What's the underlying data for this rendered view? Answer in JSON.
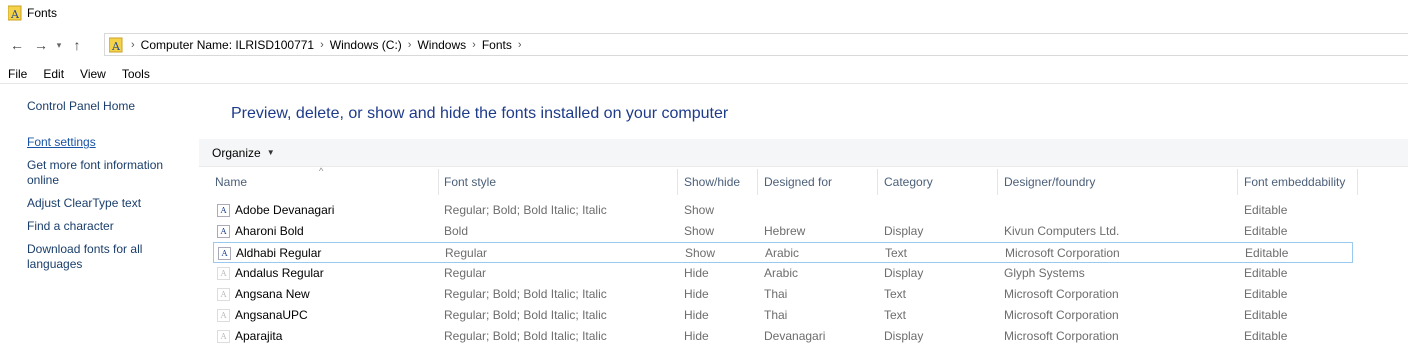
{
  "window": {
    "title": "Fonts"
  },
  "address": {
    "crumbs": [
      "Computer Name:  ILRISD100771",
      "Windows (C:)",
      "Windows",
      "Fonts"
    ]
  },
  "menu": [
    "File",
    "Edit",
    "View",
    "Tools"
  ],
  "sidebar": {
    "home": "Control Panel Home",
    "settings": "Font settings",
    "more_info": "Get more font information online",
    "cleartype": "Adjust ClearType text",
    "find_char": "Find a character",
    "download": "Download fonts for all languages"
  },
  "heading": "Preview, delete, or show and hide the fonts installed on your computer",
  "toolbar": {
    "organize": "Organize"
  },
  "columns": [
    "Name",
    "Font style",
    "Show/hide",
    "Designed for",
    "Category",
    "Designer/foundry",
    "Font embeddability"
  ],
  "fonts": [
    {
      "name": "Adobe Devanagari",
      "style": "Regular; Bold; Bold Italic; Italic",
      "show": "Show",
      "designed": "",
      "category": "",
      "designer": "",
      "embed": "Editable"
    },
    {
      "name": "Aharoni Bold",
      "style": "Bold",
      "show": "Show",
      "designed": "Hebrew",
      "category": "Display",
      "designer": "Kivun Computers Ltd.",
      "embed": "Editable"
    },
    {
      "name": "Aldhabi Regular",
      "style": "Regular",
      "show": "Show",
      "designed": "Arabic",
      "category": "Text",
      "designer": "Microsoft Corporation",
      "embed": "Editable"
    },
    {
      "name": "Andalus Regular",
      "style": "Regular",
      "show": "Hide",
      "designed": "Arabic",
      "category": "Display",
      "designer": "Glyph Systems",
      "embed": "Editable"
    },
    {
      "name": "Angsana New",
      "style": "Regular; Bold; Bold Italic; Italic",
      "show": "Hide",
      "designed": "Thai",
      "category": "Text",
      "designer": "Microsoft Corporation",
      "embed": "Editable"
    },
    {
      "name": "AngsanaUPC",
      "style": "Regular; Bold; Bold Italic; Italic",
      "show": "Hide",
      "designed": "Thai",
      "category": "Text",
      "designer": "Microsoft Corporation",
      "embed": "Editable"
    },
    {
      "name": "Aparajita",
      "style": "Regular; Bold; Bold Italic; Italic",
      "show": "Hide",
      "designed": "Devanagari",
      "category": "Display",
      "designer": "Microsoft Corporation",
      "embed": "Editable"
    }
  ],
  "selected_row": 2
}
